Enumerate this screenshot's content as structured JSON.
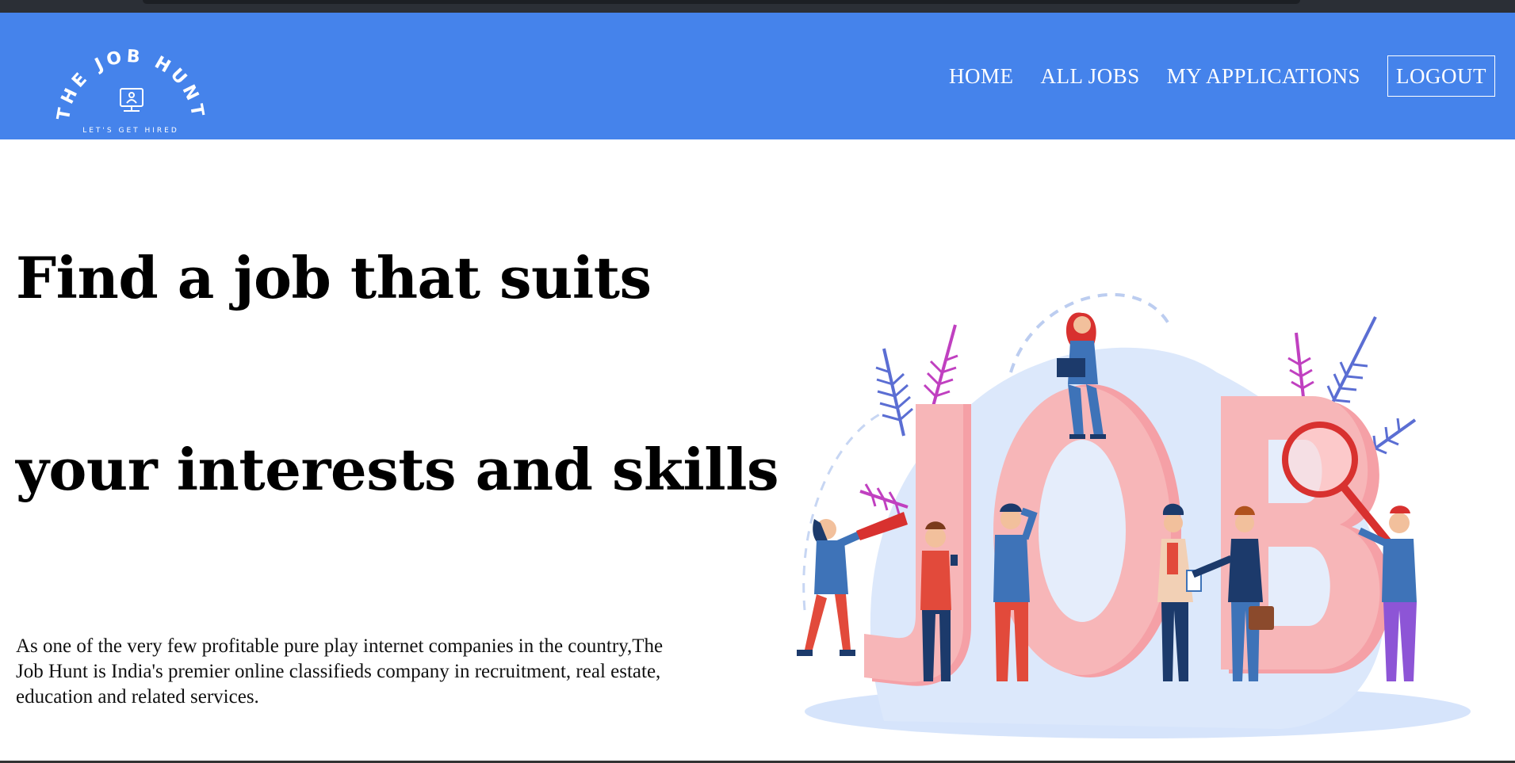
{
  "logo": {
    "top_text": "THE JOB HUNT",
    "tagline": "LET'S GET HIRED"
  },
  "nav": {
    "home": "HOME",
    "all_jobs": "ALL JOBS",
    "my_applications": "MY APPLICATIONS",
    "logout": "LOGOUT"
  },
  "hero": {
    "title_line1": "Find a job that suits",
    "title_line2": "your interests and skills",
    "description": "As one of the very few profitable pure play internet companies in the country,The Job Hunt is India's premier online classifieds company in recruitment, real estate, education and related services."
  },
  "illustration": {
    "word": "JOB"
  },
  "colors": {
    "navbar": "#4583eb",
    "letters": "#f7b3b5",
    "accent_red": "#e24a3b",
    "navy": "#1c3a6b"
  }
}
